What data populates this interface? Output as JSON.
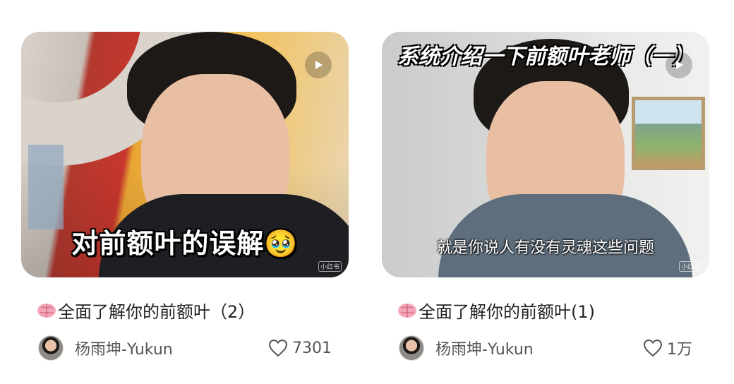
{
  "cards": [
    {
      "overlay_caption": "对前额叶的误解🥹",
      "title": "全面了解你的前额叶（2）",
      "author": "杨雨坤-Yukun",
      "likes": "7301",
      "watermark": "小红书"
    },
    {
      "overlay_top": "系统介绍一下前额叶老师（一）",
      "overlay_subtitle": "就是你说人有没有灵魂这些问题",
      "title": "全面了解你的前额叶(1)",
      "author": "杨雨坤-Yukun",
      "likes": "1万",
      "watermark": "小红书"
    }
  ],
  "icons": {
    "play": "play-icon",
    "brain": "brain-emoji-icon",
    "heart": "heart-outline-icon"
  },
  "colors": {
    "text_primary": "#222222",
    "text_secondary": "#555555",
    "play_button_bg": "rgba(0,0,0,0.22)"
  }
}
